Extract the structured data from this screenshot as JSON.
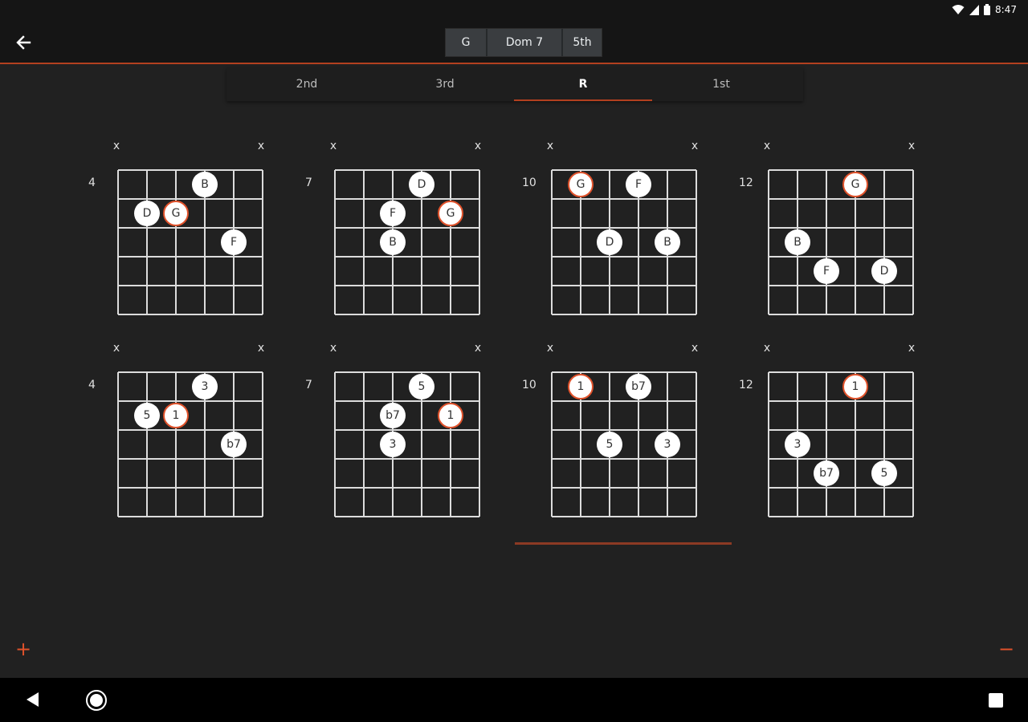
{
  "status": {
    "time": "8:47",
    "icons": [
      "wifi-icon",
      "signal-icon",
      "battery-icon"
    ]
  },
  "header": {
    "back_icon": "arrow-left-icon",
    "chord": {
      "root": "G",
      "type": "Dom 7",
      "inversion": "5th"
    }
  },
  "tabs": [
    {
      "label": "2nd",
      "active": false
    },
    {
      "label": "3rd",
      "active": false
    },
    {
      "label": "R",
      "active": true
    },
    {
      "label": "1st",
      "active": false
    }
  ],
  "colors": {
    "accent": "#e0522b",
    "background": "#212121",
    "bar": "#151515"
  },
  "rows": [
    {
      "name": "note-names",
      "diagrams": [
        {
          "fret": "4",
          "mutes": [
            "x",
            "x"
          ],
          "notes": [
            {
              "s": 3,
              "f": 1,
              "label": "B"
            },
            {
              "s": 1,
              "f": 2,
              "label": "D"
            },
            {
              "s": 2,
              "f": 2,
              "label": "G",
              "root": true
            },
            {
              "s": 4,
              "f": 3,
              "label": "F"
            }
          ]
        },
        {
          "fret": "7",
          "mutes": [
            "x",
            "x"
          ],
          "notes": [
            {
              "s": 3,
              "f": 1,
              "label": "D"
            },
            {
              "s": 2,
              "f": 2,
              "label": "F"
            },
            {
              "s": 4,
              "f": 2,
              "label": "G",
              "root": true
            },
            {
              "s": 2,
              "f": 3,
              "label": "B"
            }
          ]
        },
        {
          "fret": "10",
          "mutes": [
            "x",
            "x"
          ],
          "notes": [
            {
              "s": 1,
              "f": 1,
              "label": "G",
              "root": true
            },
            {
              "s": 3,
              "f": 1,
              "label": "F"
            },
            {
              "s": 2,
              "f": 3,
              "label": "D"
            },
            {
              "s": 4,
              "f": 3,
              "label": "B"
            }
          ]
        },
        {
          "fret": "12",
          "mutes": [
            "x",
            "x"
          ],
          "notes": [
            {
              "s": 3,
              "f": 1,
              "label": "G",
              "root": true
            },
            {
              "s": 1,
              "f": 3,
              "label": "B"
            },
            {
              "s": 2,
              "f": 4,
              "label": "F"
            },
            {
              "s": 4,
              "f": 4,
              "label": "D"
            }
          ]
        }
      ]
    },
    {
      "name": "intervals",
      "diagrams": [
        {
          "fret": "4",
          "mutes": [
            "x",
            "x"
          ],
          "notes": [
            {
              "s": 3,
              "f": 1,
              "label": "3"
            },
            {
              "s": 1,
              "f": 2,
              "label": "5"
            },
            {
              "s": 2,
              "f": 2,
              "label": "1",
              "root": true
            },
            {
              "s": 4,
              "f": 3,
              "label": "b7"
            }
          ]
        },
        {
          "fret": "7",
          "mutes": [
            "x",
            "x"
          ],
          "notes": [
            {
              "s": 3,
              "f": 1,
              "label": "5"
            },
            {
              "s": 2,
              "f": 2,
              "label": "b7"
            },
            {
              "s": 4,
              "f": 2,
              "label": "1",
              "root": true
            },
            {
              "s": 2,
              "f": 3,
              "label": "3"
            }
          ]
        },
        {
          "fret": "10",
          "mutes": [
            "x",
            "x"
          ],
          "notes": [
            {
              "s": 1,
              "f": 1,
              "label": "1",
              "root": true
            },
            {
              "s": 3,
              "f": 1,
              "label": "b7"
            },
            {
              "s": 2,
              "f": 3,
              "label": "5"
            },
            {
              "s": 4,
              "f": 3,
              "label": "3"
            }
          ]
        },
        {
          "fret": "12",
          "mutes": [
            "x",
            "x"
          ],
          "notes": [
            {
              "s": 3,
              "f": 1,
              "label": "1",
              "root": true
            },
            {
              "s": 1,
              "f": 3,
              "label": "3"
            },
            {
              "s": 2,
              "f": 4,
              "label": "b7"
            },
            {
              "s": 4,
              "f": 4,
              "label": "5"
            }
          ]
        }
      ]
    }
  ],
  "fab": {
    "add_label": "+",
    "remove_label": "−"
  },
  "nav": {
    "back": "nav-back-icon",
    "home": "nav-home-icon",
    "recents": "nav-recents-icon"
  }
}
